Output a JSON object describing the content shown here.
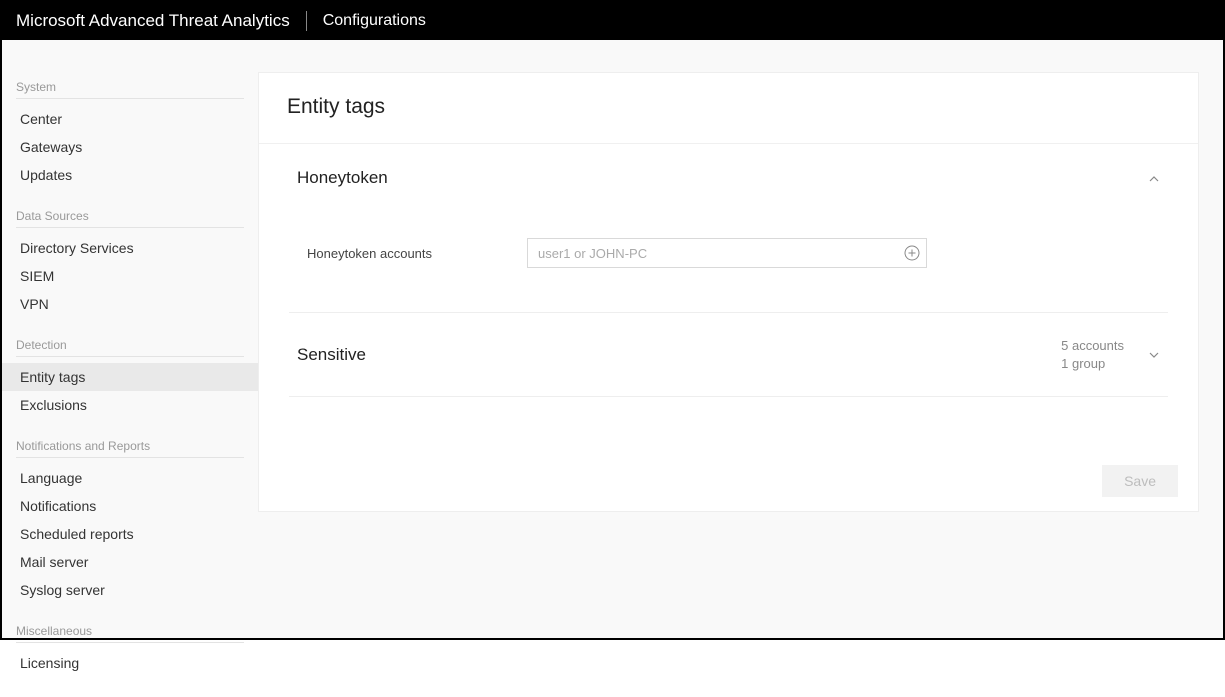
{
  "header": {
    "product": "Microsoft Advanced Threat Analytics",
    "page": "Configurations"
  },
  "sidebar": {
    "groups": [
      {
        "label": "System",
        "items": [
          {
            "label": "Center"
          },
          {
            "label": "Gateways"
          },
          {
            "label": "Updates"
          }
        ]
      },
      {
        "label": "Data Sources",
        "items": [
          {
            "label": "Directory Services"
          },
          {
            "label": "SIEM"
          },
          {
            "label": "VPN"
          }
        ]
      },
      {
        "label": "Detection",
        "items": [
          {
            "label": "Entity tags",
            "active": true
          },
          {
            "label": "Exclusions"
          }
        ]
      },
      {
        "label": "Notifications and Reports",
        "items": [
          {
            "label": "Language"
          },
          {
            "label": "Notifications"
          },
          {
            "label": "Scheduled reports"
          },
          {
            "label": "Mail server"
          },
          {
            "label": "Syslog server"
          }
        ]
      },
      {
        "label": "Miscellaneous",
        "items": [
          {
            "label": "Licensing"
          }
        ]
      }
    ]
  },
  "main": {
    "title": "Entity tags",
    "honeytoken": {
      "title": "Honeytoken",
      "field_label": "Honeytoken accounts",
      "placeholder": "user1 or JOHN-PC"
    },
    "sensitive": {
      "title": "Sensitive",
      "accounts_line": "5 accounts",
      "groups_line": "1 group"
    },
    "save_label": "Save"
  }
}
